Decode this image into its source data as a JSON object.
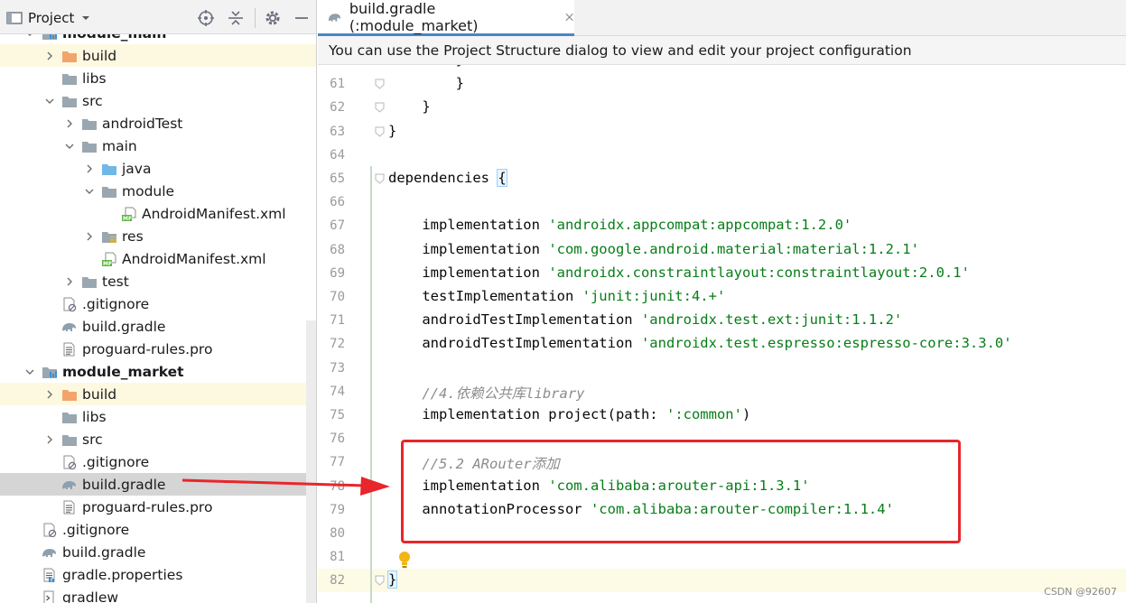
{
  "project_panel": {
    "title": "Project",
    "tree": [
      {
        "label": "module_main",
        "depth": 1,
        "expanded": true,
        "icon": "module-folder-icon",
        "bold": true,
        "partial": true
      },
      {
        "label": "build",
        "depth": 2,
        "expanded": false,
        "icon": "build-folder-icon",
        "highlight": "yellow"
      },
      {
        "label": "libs",
        "depth": 2,
        "expanded": null,
        "icon": "folder-icon"
      },
      {
        "label": "src",
        "depth": 2,
        "expanded": true,
        "icon": "folder-icon"
      },
      {
        "label": "androidTest",
        "depth": 3,
        "expanded": false,
        "icon": "folder-icon"
      },
      {
        "label": "main",
        "depth": 3,
        "expanded": true,
        "icon": "folder-icon"
      },
      {
        "label": "java",
        "depth": 4,
        "expanded": false,
        "icon": "source-folder-icon"
      },
      {
        "label": "module",
        "depth": 4,
        "expanded": true,
        "icon": "folder-icon"
      },
      {
        "label": "AndroidManifest.xml",
        "depth": 5,
        "expanded": null,
        "icon": "manifest-file-icon"
      },
      {
        "label": "res",
        "depth": 4,
        "expanded": false,
        "icon": "resource-folder-icon"
      },
      {
        "label": "AndroidManifest.xml",
        "depth": 4,
        "expanded": null,
        "icon": "manifest-file-icon"
      },
      {
        "label": "test",
        "depth": 3,
        "expanded": false,
        "icon": "folder-icon"
      },
      {
        "label": ".gitignore",
        "depth": 2,
        "expanded": null,
        "icon": "gitignore-file-icon"
      },
      {
        "label": "build.gradle",
        "depth": 2,
        "expanded": null,
        "icon": "gradle-file-icon"
      },
      {
        "label": "proguard-rules.pro",
        "depth": 2,
        "expanded": null,
        "icon": "text-file-icon"
      },
      {
        "label": "module_market",
        "depth": 1,
        "expanded": true,
        "icon": "module-folder-icon",
        "bold": true
      },
      {
        "label": "build",
        "depth": 2,
        "expanded": false,
        "icon": "build-folder-icon",
        "highlight": "yellow"
      },
      {
        "label": "libs",
        "depth": 2,
        "expanded": null,
        "icon": "folder-icon"
      },
      {
        "label": "src",
        "depth": 2,
        "expanded": false,
        "icon": "folder-icon"
      },
      {
        "label": ".gitignore",
        "depth": 2,
        "expanded": null,
        "icon": "gitignore-file-icon"
      },
      {
        "label": "build.gradle",
        "depth": 2,
        "expanded": null,
        "icon": "gradle-file-icon",
        "highlight": "selected"
      },
      {
        "label": "proguard-rules.pro",
        "depth": 2,
        "expanded": null,
        "icon": "text-file-icon"
      },
      {
        "label": ".gitignore",
        "depth": 1,
        "expanded": null,
        "icon": "gitignore-file-icon"
      },
      {
        "label": "build.gradle",
        "depth": 1,
        "expanded": null,
        "icon": "gradle-file-icon"
      },
      {
        "label": "gradle.properties",
        "depth": 1,
        "expanded": null,
        "icon": "properties-file-icon"
      },
      {
        "label": "gradlew",
        "depth": 1,
        "expanded": null,
        "icon": "script-file-icon"
      }
    ]
  },
  "editor": {
    "tab_label": "build.gradle (:module_market)",
    "notice": "You can use the Project Structure dialog to view and edit your project configuration",
    "lines": [
      {
        "n": "",
        "parts": [
          {
            "t": "        }",
            "k": "code"
          }
        ]
      },
      {
        "n": "61",
        "parts": [
          {
            "t": "        }",
            "k": "code"
          }
        ],
        "fold": true
      },
      {
        "n": "62",
        "parts": [
          {
            "t": "    }",
            "k": "code"
          }
        ],
        "fold": true
      },
      {
        "n": "63",
        "parts": [
          {
            "t": "}",
            "k": "code"
          }
        ],
        "fold": true
      },
      {
        "n": "64",
        "parts": []
      },
      {
        "n": "65",
        "parts": [
          {
            "t": "dependencies ",
            "k": "code"
          },
          {
            "t": "{",
            "k": "brace"
          }
        ],
        "fold": true
      },
      {
        "n": "66",
        "parts": []
      },
      {
        "n": "67",
        "parts": [
          {
            "t": "    implementation ",
            "k": "code"
          },
          {
            "t": "'androidx.appcompat:appcompat:1.2.0'",
            "k": "str"
          }
        ]
      },
      {
        "n": "68",
        "parts": [
          {
            "t": "    implementation ",
            "k": "code"
          },
          {
            "t": "'com.google.android.material:material:1.2.1'",
            "k": "str"
          }
        ]
      },
      {
        "n": "69",
        "parts": [
          {
            "t": "    implementation ",
            "k": "code"
          },
          {
            "t": "'androidx.constraintlayout:constraintlayout:2.0.1'",
            "k": "str"
          }
        ]
      },
      {
        "n": "70",
        "parts": [
          {
            "t": "    testImplementation ",
            "k": "code"
          },
          {
            "t": "'junit:junit:4.+'",
            "k": "str"
          }
        ]
      },
      {
        "n": "71",
        "parts": [
          {
            "t": "    androidTestImplementation ",
            "k": "code"
          },
          {
            "t": "'androidx.test.ext:junit:1.1.2'",
            "k": "str"
          }
        ]
      },
      {
        "n": "72",
        "parts": [
          {
            "t": "    androidTestImplementation ",
            "k": "code"
          },
          {
            "t": "'androidx.test.espresso:espresso-core:3.3.0'",
            "k": "str"
          }
        ]
      },
      {
        "n": "73",
        "parts": []
      },
      {
        "n": "74",
        "parts": [
          {
            "t": "    //4.依赖公共库library",
            "k": "cmt"
          }
        ]
      },
      {
        "n": "75",
        "parts": [
          {
            "t": "    implementation project(path: ",
            "k": "code"
          },
          {
            "t": "':common'",
            "k": "str"
          },
          {
            "t": ")",
            "k": "code"
          }
        ]
      },
      {
        "n": "76",
        "parts": []
      },
      {
        "n": "77",
        "parts": [
          {
            "t": "    //5.2 ARouter添加",
            "k": "cmt"
          }
        ]
      },
      {
        "n": "78",
        "parts": [
          {
            "t": "    implementation ",
            "k": "code"
          },
          {
            "t": "'com.alibaba:arouter-api:1.3.1'",
            "k": "str"
          }
        ]
      },
      {
        "n": "79",
        "parts": [
          {
            "t": "    annotationProcessor ",
            "k": "code"
          },
          {
            "t": "'com.alibaba:arouter-compiler:1.1.4'",
            "k": "str"
          }
        ]
      },
      {
        "n": "80",
        "parts": []
      },
      {
        "n": "81",
        "parts": []
      },
      {
        "n": "82",
        "parts": [
          {
            "t": "}",
            "k": "brace"
          }
        ],
        "fold": true,
        "current": true
      }
    ]
  },
  "watermark": "CSDN @92607",
  "colors": {
    "string": "#067d17",
    "comment": "#8c8c8c",
    "annotation_red": "#e8262b",
    "selection": "#d5d5d5",
    "excluded_highlight": "#fdf9e1"
  }
}
